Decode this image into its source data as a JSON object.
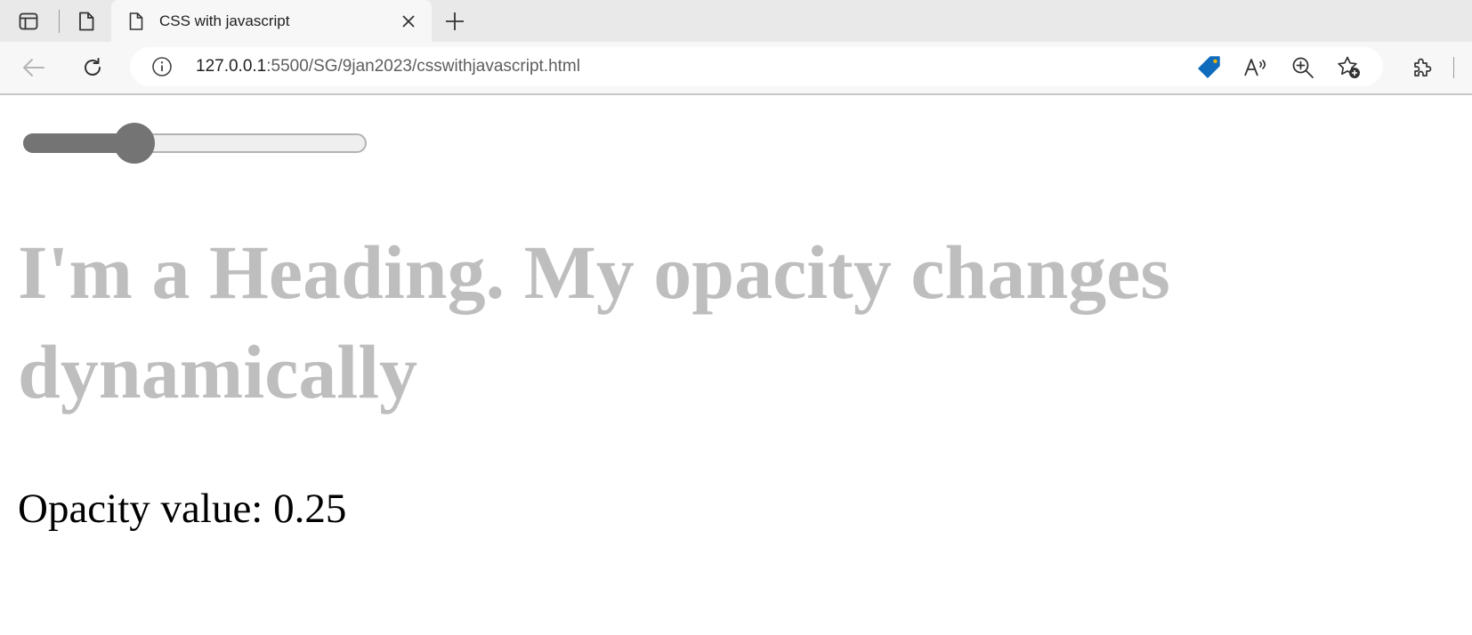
{
  "browser": {
    "tab": {
      "title": "CSS with javascript"
    },
    "address_bar": {
      "host": "127.0.0.1",
      "path": ":5500/SG/9jan2023/csswithjavascript.html"
    }
  },
  "page": {
    "slider": {
      "value": 0.25,
      "min": 0,
      "max": 1,
      "fill_color": "#747474",
      "track_color": "#efefef"
    },
    "heading": {
      "text": "I'm a Heading. My opacity changes dynamically",
      "opacity": 0.25
    },
    "opacity_label": {
      "prefix": "Opacity value: ",
      "value": "0.25"
    }
  },
  "icons": {
    "tab_actions": "tab-actions-icon",
    "workspaces": "document-icon",
    "tab_page": "page-icon",
    "close": "close-icon",
    "new_tab": "plus-icon",
    "back": "back-arrow-icon",
    "refresh": "refresh-icon",
    "site_info": "info-icon",
    "coupons": "tag-icon",
    "read_aloud": "read-aloud-icon",
    "zoom": "zoom-icon",
    "favorites": "favorites-icon",
    "extensions": "puzzle-icon"
  }
}
